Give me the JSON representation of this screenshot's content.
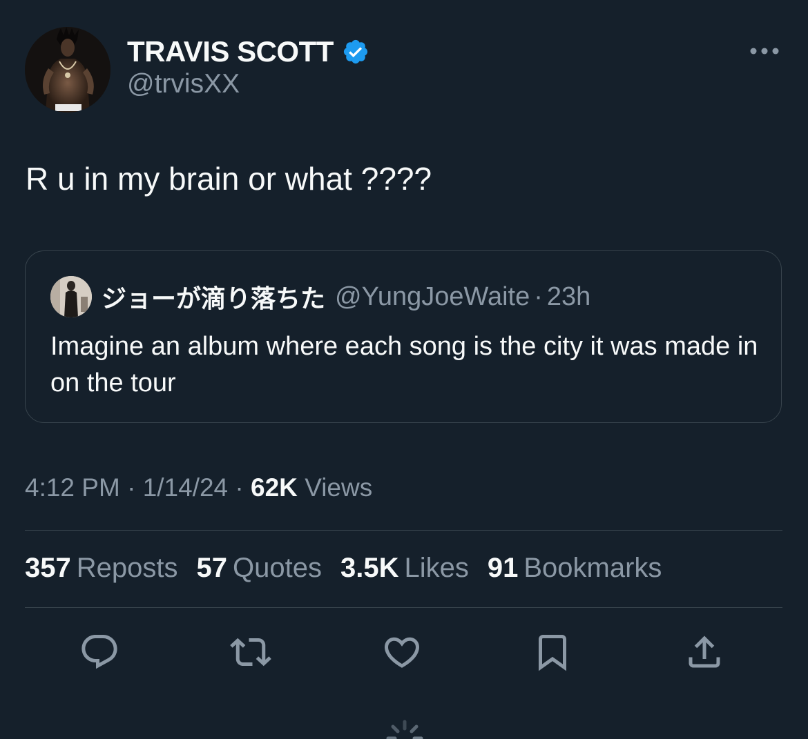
{
  "author": {
    "display_name": "TRAVIS SCOTT",
    "handle": "@trvisXX",
    "verified": true,
    "avatar_icon": "profile-photo"
  },
  "tweet": {
    "text": "R u in my brain or what ????"
  },
  "quote": {
    "display_name": "ジョーが滴り落ちた",
    "handle": "@YungJoeWaite",
    "separator": "·",
    "time": "23h",
    "text": "Imagine an album where each song is the city it was made in on the tour"
  },
  "meta": {
    "time": "4:12 PM",
    "separator": "·",
    "date": "1/14/24",
    "views_count": "62K",
    "views_label": "Views"
  },
  "stats": [
    {
      "count": "357",
      "label": "Reposts"
    },
    {
      "count": "57",
      "label": "Quotes"
    },
    {
      "count": "3.5K",
      "label": "Likes"
    },
    {
      "count": "91",
      "label": "Bookmarks"
    }
  ],
  "actions": [
    "reply-icon",
    "repost-icon",
    "like-icon",
    "bookmark-icon",
    "share-icon"
  ],
  "colors": {
    "background": "#15202b",
    "text_primary": "#f7f9f9",
    "text_secondary": "#8b98a5",
    "border": "#38444d",
    "verified_blue": "#1d9bf0"
  }
}
